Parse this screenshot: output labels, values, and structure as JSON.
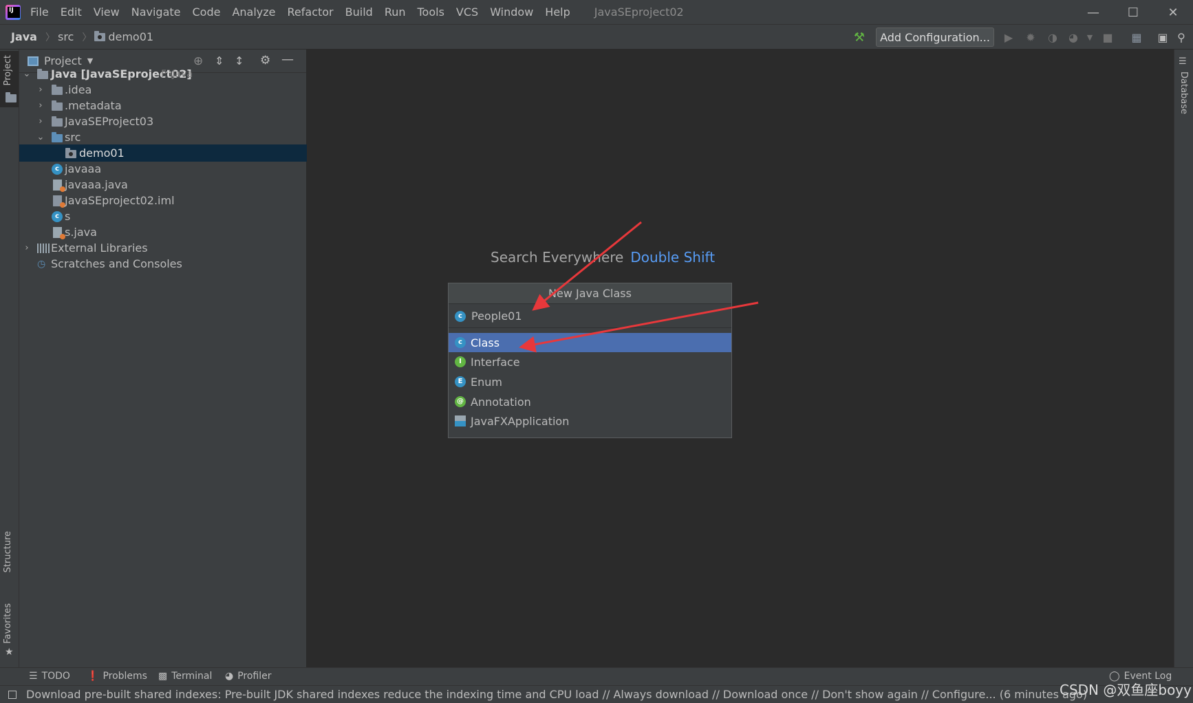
{
  "window": {
    "menu": [
      "File",
      "Edit",
      "View",
      "Navigate",
      "Code",
      "Analyze",
      "Refactor",
      "Build",
      "Run",
      "Tools",
      "VCS",
      "Window",
      "Help"
    ],
    "title": "JavaSEproject02"
  },
  "navbar": {
    "crumbs": [
      "Java",
      "src",
      "demo01"
    ],
    "add_configuration": "Add Configuration..."
  },
  "left_stripe": {
    "project_tab": "Project",
    "structure_tab": "Structure",
    "favorites_tab": "Favorites"
  },
  "right_stripe": {
    "database_tab": "Database"
  },
  "project_panel": {
    "title": "Project",
    "tree": [
      {
        "label": "Java [JavaSEproject02]",
        "path": "F:\\Java",
        "type": "module",
        "expanded": true
      },
      {
        "label": ".idea",
        "type": "folder",
        "expanded": false
      },
      {
        "label": ".metadata",
        "type": "folder",
        "expanded": false
      },
      {
        "label": "JavaSEProject03",
        "type": "folder",
        "expanded": false
      },
      {
        "label": "src",
        "type": "source-folder",
        "expanded": true
      },
      {
        "label": "demo01",
        "type": "package",
        "selected": true
      },
      {
        "label": "javaaa",
        "type": "class"
      },
      {
        "label": "javaaa.java",
        "type": "java-file"
      },
      {
        "label": "JavaSEproject02.iml",
        "type": "iml-file"
      },
      {
        "label": "s",
        "type": "class"
      },
      {
        "label": "s.java",
        "type": "java-file"
      },
      {
        "label": "External Libraries",
        "type": "libraries",
        "expanded": false
      },
      {
        "label": "Scratches and Consoles",
        "type": "scratches"
      }
    ]
  },
  "editor": {
    "hint_text": "Search Everywhere",
    "hint_key": "Double Shift"
  },
  "new_class_popup": {
    "title": "New Java Class",
    "input_value": "People01",
    "options": [
      {
        "label": "Class",
        "icon": "C",
        "selected": true
      },
      {
        "label": "Interface",
        "icon": "I"
      },
      {
        "label": "Enum",
        "icon": "E"
      },
      {
        "label": "Annotation",
        "icon": "@"
      },
      {
        "label": "JavaFXApplication",
        "icon": "fx"
      }
    ]
  },
  "bottom_tabs": [
    "TODO",
    "Problems",
    "Terminal",
    "Profiler"
  ],
  "event_log": "Event Log",
  "status_message": "Download pre-built shared indexes: Pre-built JDK shared indexes reduce the indexing time and CPU load // Always download // Download once // Don't show again // Configure... (6 minutes ago)",
  "watermark": "CSDN @双鱼座boyy",
  "colors": {
    "accent": "#4b6eaf",
    "hint_key": "#589df6",
    "selection": "#0d293e",
    "arrow": "#e8383b"
  }
}
